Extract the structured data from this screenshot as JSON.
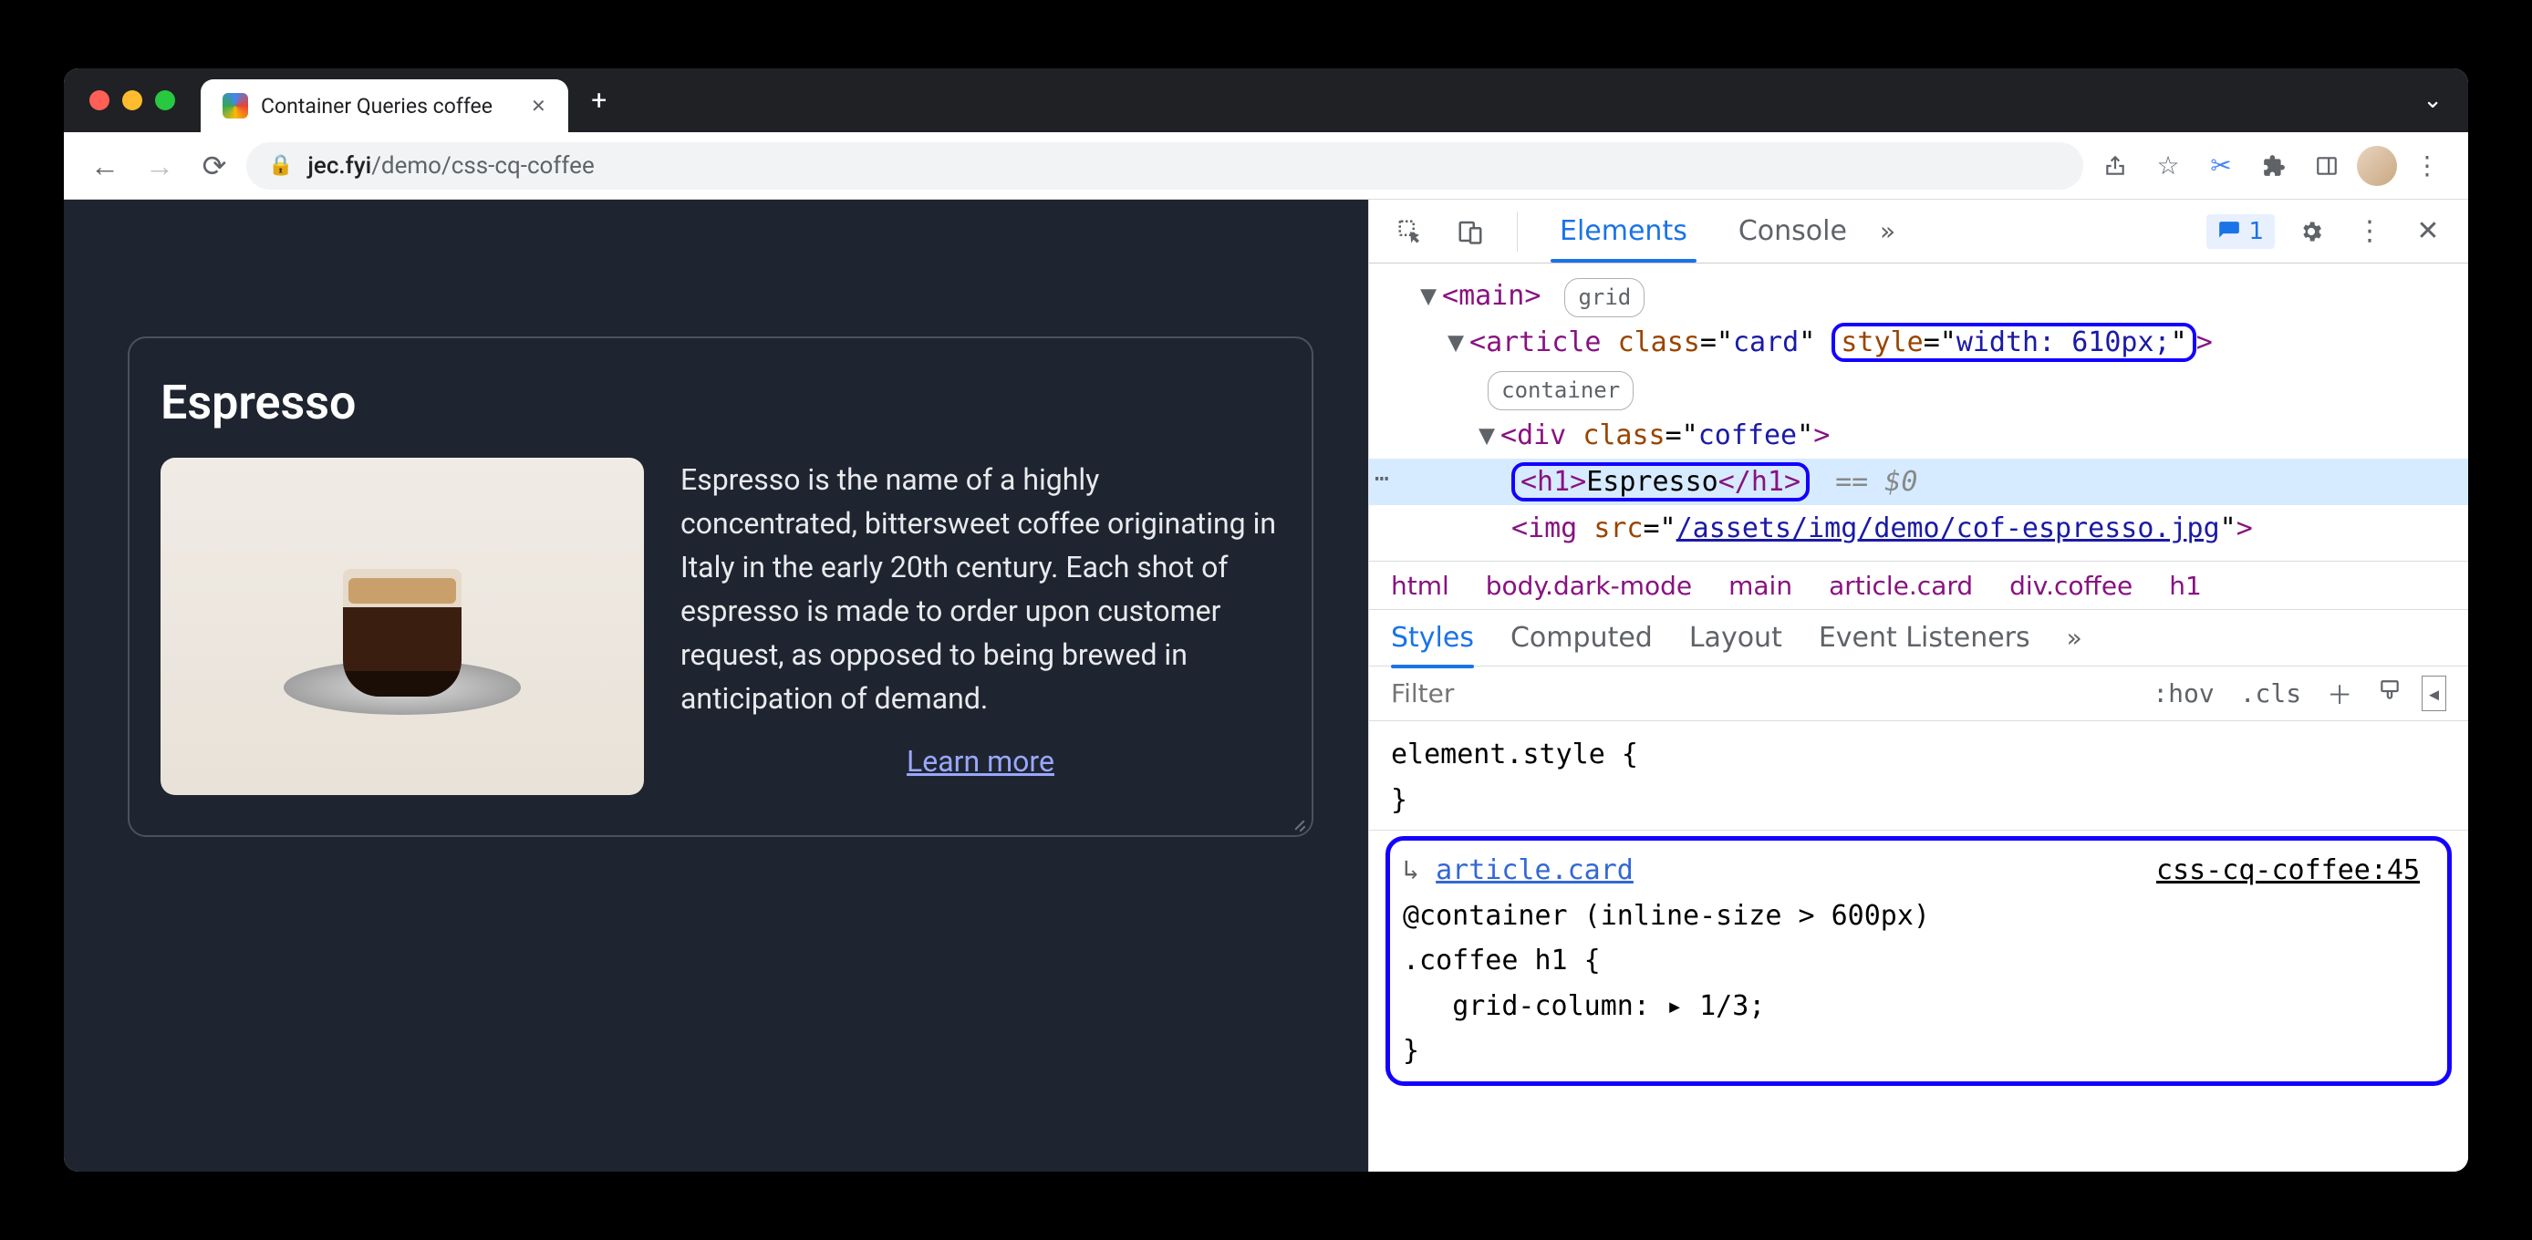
{
  "browser": {
    "tab_title": "Container Queries coffee",
    "url_host": "jec.fyi",
    "url_path": "/demo/css-cq-coffee"
  },
  "page": {
    "heading": "Espresso",
    "description": "Espresso is the name of a highly concentrated, bittersweet coffee originating in Italy in the early 20th century. Each shot of espresso is made to order upon customer request, as opposed to being brewed in anticipation of demand.",
    "learn_more": "Learn more"
  },
  "devtools": {
    "tabs": {
      "elements": "Elements",
      "console": "Console"
    },
    "issues_count": "1",
    "dom": {
      "main_tag": "main",
      "main_badge": "grid",
      "article_open": "article",
      "article_class_attr": "class",
      "article_class_val": "card",
      "article_style_attr": "style",
      "article_style_val": "width: 610px;",
      "container_badge": "container",
      "div_tag": "div",
      "div_class_attr": "class",
      "div_class_val": "coffee",
      "h1_open": "<h1>",
      "h1_text": "Espresso",
      "h1_close": "</h1>",
      "eq0": "== $0",
      "img_tag": "img",
      "img_src_attr": "src",
      "img_src_val": "/assets/img/demo/cof-espresso.jpg"
    },
    "breadcrumbs": {
      "html": "html",
      "body": "body.dark-mode",
      "main": "main",
      "article": "article.card",
      "div": "div.coffee",
      "h1": "h1"
    },
    "styles_tabs": {
      "styles": "Styles",
      "computed": "Computed",
      "layout": "Layout",
      "event": "Event Listeners"
    },
    "styles_tools": {
      "filter": "Filter",
      "hov": ":hov",
      "cls": ".cls"
    },
    "styles": {
      "element_style": "element.style {",
      "element_style_close": "}",
      "container_link_prefix": "↳",
      "container_link": "article.card",
      "container_query": "@container (inline-size > 600px)",
      "selector": ".coffee h1 {",
      "prop": "grid-column",
      "prop_expand": "▸",
      "val": "1/3;",
      "close": "}",
      "source": "css-cq-coffee:45"
    }
  }
}
